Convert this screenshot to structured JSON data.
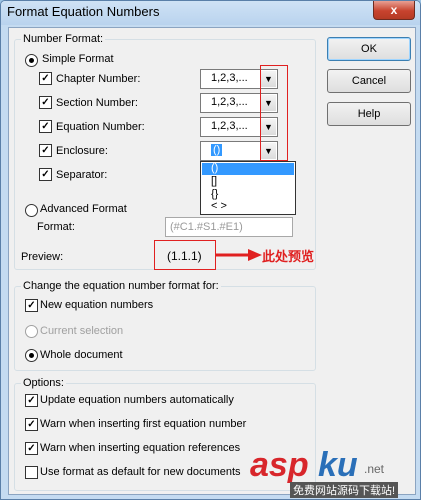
{
  "window": {
    "title": "Format Equation Numbers",
    "close_glyph": "x"
  },
  "number_format": {
    "group_label": "Number Format:",
    "simple": {
      "label": "Simple Format",
      "chapter_label": "Chapter Number:",
      "chapter_value": "1,2,3,...",
      "section_label": "Section Number:",
      "section_value": "1,2,3,...",
      "equation_label": "Equation Number:",
      "equation_value": "1,2,3,...",
      "enclosure_label": "Enclosure:",
      "enclosure_value": "()",
      "enclosure_options": [
        "()",
        "[]",
        "{}",
        "< >"
      ],
      "separator_label": "Separator:"
    },
    "advanced": {
      "label": "Advanced Format",
      "format_label": "Format:",
      "format_value": "(#C1.#S1.#E1)"
    },
    "preview_label": "Preview:",
    "preview_value": "(1.1.1)",
    "annotation_text": "此处预览"
  },
  "change_for": {
    "group_label": "Change the equation number format for:",
    "new_equation_numbers": "New equation numbers",
    "current_selection": "Current selection",
    "whole_document": "Whole document"
  },
  "options": {
    "group_label": "Options:",
    "update_auto": "Update equation numbers automatically",
    "warn_first": "Warn when inserting first equation number",
    "warn_refs": "Warn when inserting equation references",
    "use_default": "Use format as default for new documents"
  },
  "buttons": {
    "ok": "OK",
    "cancel": "Cancel",
    "help": "Help"
  },
  "checkmark": "✓",
  "watermark": {
    "brand_a": "asp",
    "brand_b": "ku",
    "suffix": ".net",
    "tagline": "免费网站源码下载站!"
  },
  "colors": {
    "annotation_red": "#e02020",
    "selection_blue": "#3399ff"
  }
}
